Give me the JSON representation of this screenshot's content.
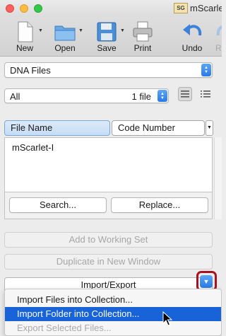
{
  "window": {
    "title": "mScarlet",
    "doc_badge": "SG"
  },
  "toolbar": {
    "new_label": "New",
    "open_label": "Open",
    "save_label": "Save",
    "print_label": "Print",
    "undo_label": "Undo",
    "redo_label": "Re"
  },
  "file_type_popup": {
    "value": "DNA Files"
  },
  "filter_popup": {
    "value": "All",
    "count": "1 file"
  },
  "table": {
    "columns": [
      "File Name",
      "Code Number"
    ],
    "rows": [
      {
        "file_name": "mScarlet-I"
      }
    ]
  },
  "panel_buttons": {
    "search": "Search...",
    "replace": "Replace..."
  },
  "actions": {
    "add_to_working_set": "Add to Working Set",
    "duplicate_in_new_window": "Duplicate in New Window",
    "import_export": "Import/Export"
  },
  "import_menu": {
    "items": [
      {
        "label": "Import Files into Collection...",
        "state": "normal"
      },
      {
        "label": "Import Folder into Collection...",
        "state": "selected"
      },
      {
        "label": "Export Selected Files...",
        "state": "disabled"
      }
    ]
  },
  "colors": {
    "accent": "#1863d8",
    "highlight_ring": "#a8121d",
    "window_bg": "#ececec"
  }
}
